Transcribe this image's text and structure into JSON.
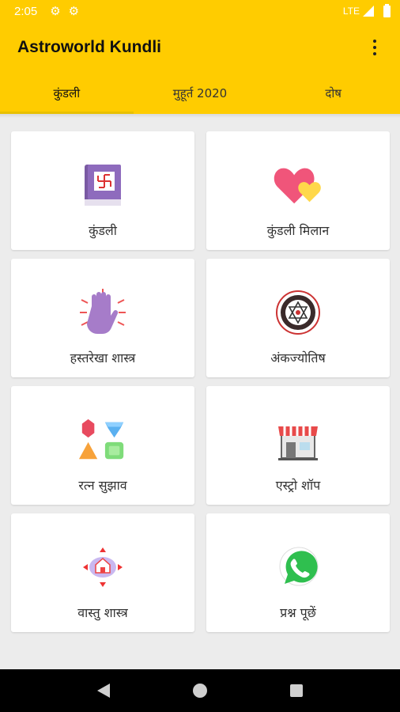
{
  "status": {
    "time": "2:05",
    "network": "LTE"
  },
  "app": {
    "title": "Astroworld Kundli"
  },
  "tabs": [
    {
      "label": "कुंडली",
      "active": true
    },
    {
      "label": "मुहूर्त 2020",
      "active": false
    },
    {
      "label": "दोष",
      "active": false
    }
  ],
  "cards": [
    {
      "label": "कुंडली",
      "icon": "kundli-book-icon"
    },
    {
      "label": "कुंडली मिलान",
      "icon": "hearts-icon"
    },
    {
      "label": "हस्तरेखा शास्त्र",
      "icon": "palm-icon"
    },
    {
      "label": "अंकज्योतिष",
      "icon": "numerology-wheel-icon"
    },
    {
      "label": "रत्न सुझाव",
      "icon": "gems-icon"
    },
    {
      "label": "एस्ट्रो शॉप",
      "icon": "shop-icon"
    },
    {
      "label": "वास्तु शास्त्र",
      "icon": "vastu-house-icon"
    },
    {
      "label": "प्रश्न पूछें",
      "icon": "whatsapp-icon"
    }
  ],
  "colors": {
    "primary": "#ffcc00",
    "background": "#ececec",
    "card": "#ffffff"
  }
}
